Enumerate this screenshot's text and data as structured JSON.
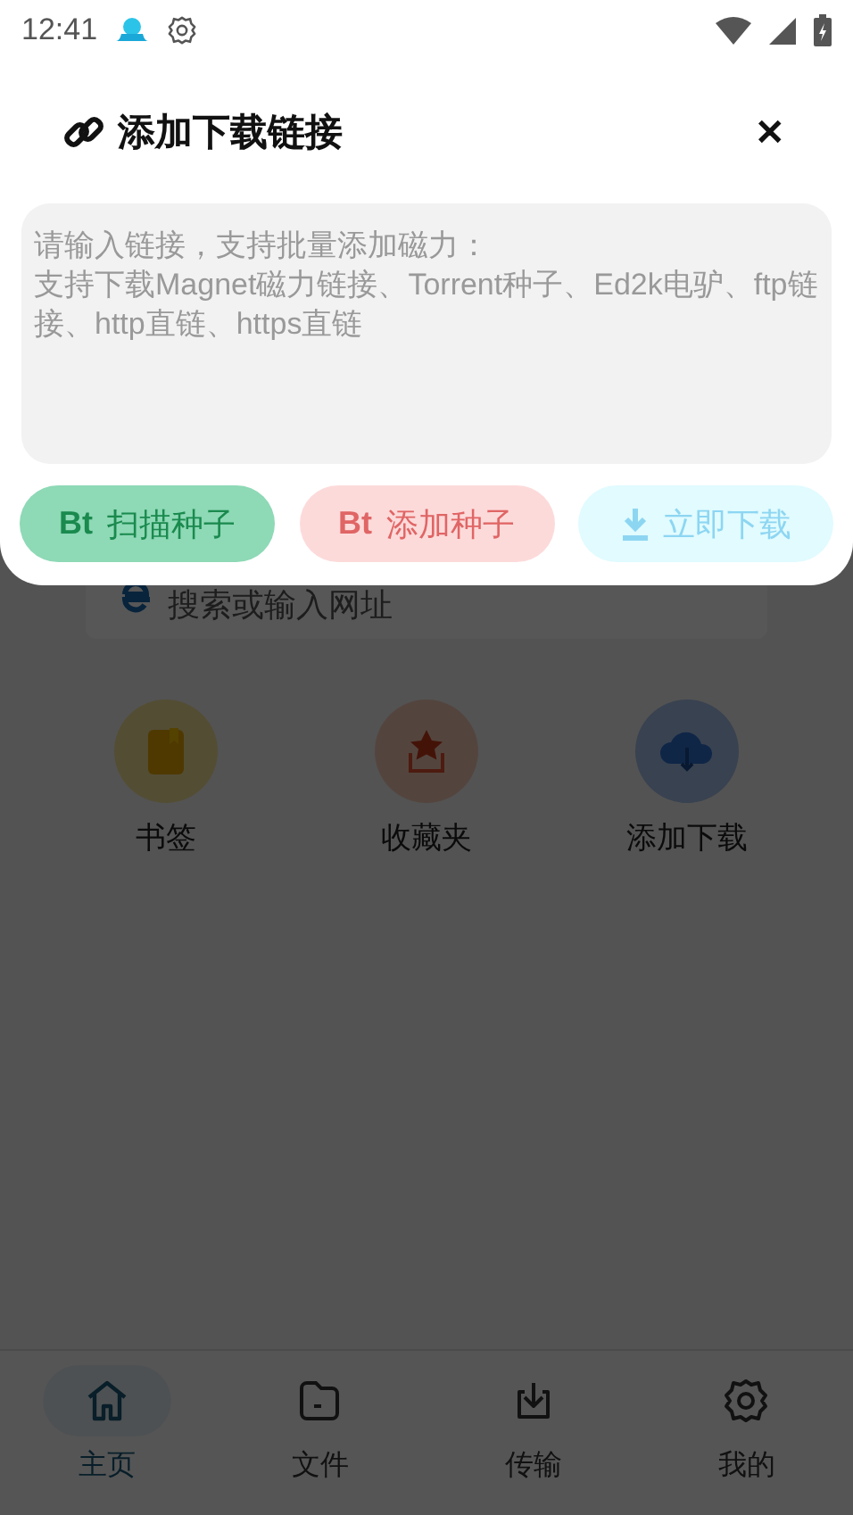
{
  "status_bar": {
    "time": "12:41"
  },
  "dialog": {
    "title": "添加下载链接",
    "close": "✕",
    "link_field": {
      "placeholder_lines": [
        "请输入链接，支持批量添加磁力：",
        "支持下载Magnet磁力链接、Torrent种子、Ed2k电驴、ftp链接、http直链、https直链"
      ]
    },
    "buttons": [
      {
        "kind": "scan",
        "badge": "Bt",
        "label": "扫描种子"
      },
      {
        "kind": "add",
        "badge": "Bt",
        "label": "添加种子"
      },
      {
        "kind": "download",
        "label": "立即下载"
      }
    ]
  },
  "search_bar": {
    "placeholder": "搜索或输入网址"
  },
  "shortcuts": [
    {
      "kind": "bookmark",
      "label": "书签"
    },
    {
      "kind": "favorites",
      "label": "收藏夹"
    },
    {
      "kind": "add-download",
      "label": "添加下载"
    }
  ],
  "nav": [
    {
      "kind": "home",
      "label": "主页",
      "selected": true
    },
    {
      "kind": "files",
      "label": "文件",
      "selected": false
    },
    {
      "kind": "transfer",
      "label": "传输",
      "selected": false
    },
    {
      "kind": "mine",
      "label": "我的",
      "selected": false
    }
  ]
}
